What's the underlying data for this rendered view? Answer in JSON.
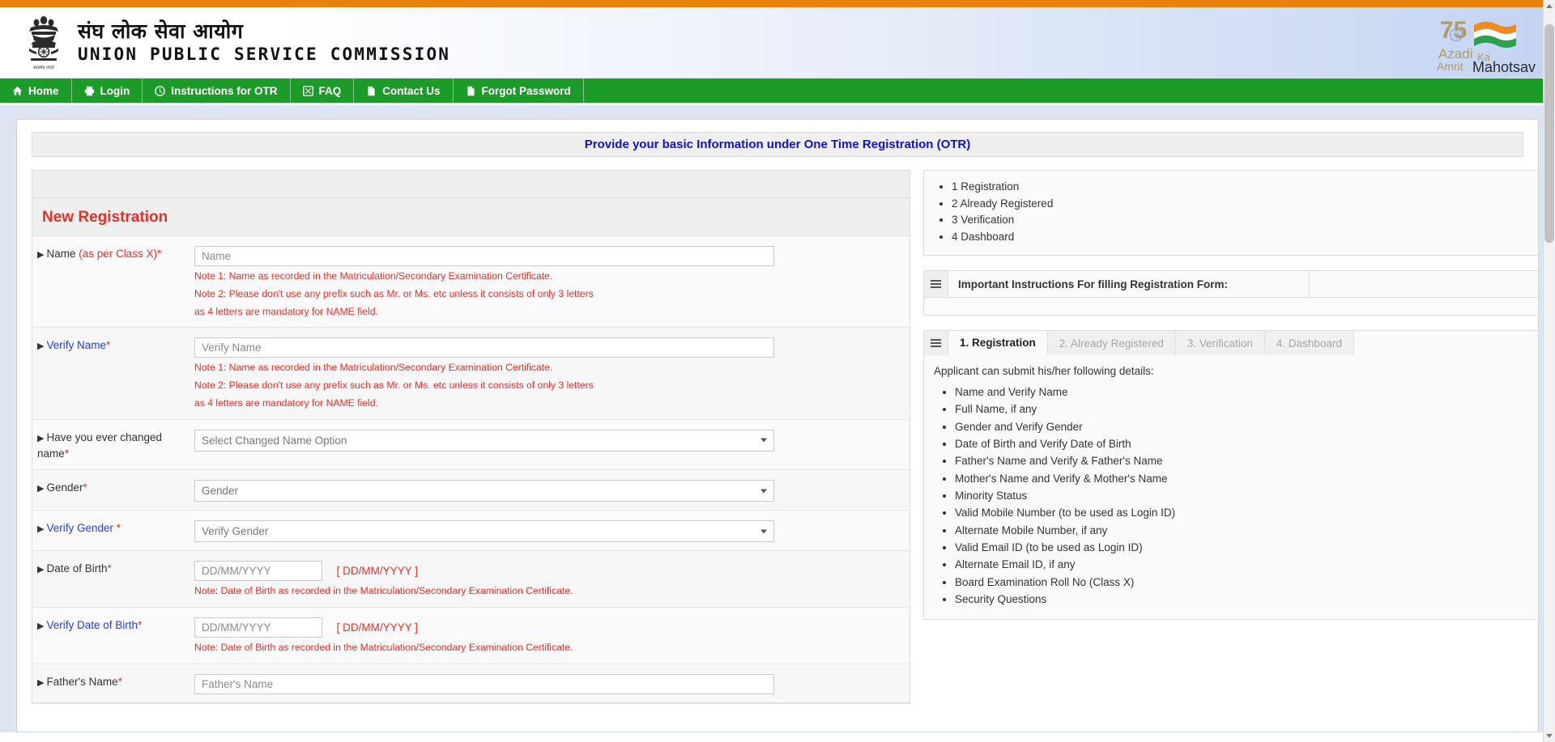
{
  "header": {
    "title_hi": "संघ लोक सेवा आयोग",
    "title_en": "UNION PUBLIC SERVICE COMMISSION",
    "azadi": {
      "num": "75",
      "line1": "Azadi",
      "line2": "Ka",
      "line3": "Amrit",
      "line4": "Mahotsav"
    }
  },
  "nav": {
    "items": [
      {
        "label": "Home",
        "icon": "home-icon"
      },
      {
        "label": "Login",
        "icon": "login-icon"
      },
      {
        "label": "Instructions for OTR",
        "icon": "clock-icon"
      },
      {
        "label": "FAQ",
        "icon": "faq-icon"
      },
      {
        "label": "Contact Us",
        "icon": "page-icon"
      },
      {
        "label": "Forgot Password",
        "icon": "page-icon"
      }
    ]
  },
  "banner": {
    "text": "Provide your basic Information under One Time Registration (OTR)"
  },
  "form": {
    "title": "New Registration",
    "rows": [
      {
        "label_main": "Name ",
        "label_paren": "(as per Class X)",
        "label_star": "*",
        "type": "input",
        "placeholder": "Name",
        "notes": [
          "Note 1: Name as recorded in the Matriculation/Secondary Examination Certificate.",
          "Note 2: Please don't use any prefix such as Mr. or Ms. etc unless it consists of only 3 letters",
          "as 4 letters are mandatory for NAME field."
        ]
      },
      {
        "label_main": "Verify Name",
        "label_blue": true,
        "label_star": "*",
        "type": "input",
        "placeholder": "Verify Name",
        "notes": [
          "Note 1: Name as recorded in the Matriculation/Secondary Examination Certificate.",
          "Note 2: Please don't use any prefix such as Mr. or Ms. etc unless it consists of only 3 letters",
          "as 4 letters are mandatory for NAME field."
        ]
      },
      {
        "label_main": "Have you ever changed name",
        "label_star": "*",
        "type": "select",
        "value": "Select Changed Name Option",
        "notes": []
      },
      {
        "label_main": "Gender",
        "label_star": "*",
        "type": "select",
        "value": "Gender",
        "notes": []
      },
      {
        "label_main": "Verify Gender ",
        "label_blue": true,
        "label_star": "*",
        "type": "select",
        "value": "Verify Gender",
        "notes": []
      },
      {
        "label_main": "Date of Birth",
        "label_star": "*",
        "type": "date",
        "placeholder": "DD/MM/YYYY",
        "format_hint": "[ DD/MM/YYYY ]",
        "notes": [
          "Note: Date of Birth as recorded in the Matriculation/Secondary Examination Certificate."
        ]
      },
      {
        "label_main": "Verify Date of Birth",
        "label_blue": true,
        "label_star": "*",
        "type": "date",
        "placeholder": "DD/MM/YYYY",
        "format_hint": "[ DD/MM/YYYY ]",
        "notes": [
          "Note: Date of Birth as recorded in the Matriculation/Secondary Examination Certificate."
        ]
      },
      {
        "label_main": "Father's Name",
        "label_star": "*",
        "type": "input",
        "placeholder": "Father's Name",
        "notes": []
      }
    ]
  },
  "sidebar": {
    "steps": [
      "1 Registration",
      "2 Already Registered",
      "3 Verification",
      "4 Dashboard"
    ],
    "accordion_title": "Important Instructions For filling Registration Form:",
    "tabs": [
      {
        "label": "1. Registration",
        "active": true
      },
      {
        "label": "2. Already Registered",
        "active": false
      },
      {
        "label": "3. Verification",
        "active": false
      },
      {
        "label": "4. Dashboard",
        "active": false
      }
    ],
    "tab_lead": "Applicant can submit his/her following details:",
    "tab_items": [
      "Name and Verify Name",
      "Full Name, if any",
      "Gender and Verify Gender",
      "Date of Birth and Verify Date of Birth",
      "Father's Name and Verify & Father's Name",
      "Mother's Name and Verify & Mother's Name",
      "Minority Status",
      "Valid Mobile Number (to be used as Login ID)",
      "Alternate Mobile Number, if any",
      "Valid Email ID (to be used as Login ID)",
      "Alternate Email ID, if any",
      "Board Examination Roll No (Class X)",
      "Security Questions"
    ]
  },
  "colors": {
    "orange": "#e8820c",
    "green": "#1d9b29",
    "banner_blue": "#1111cc",
    "red": "#e8302a",
    "link_blue": "#2b3fd6",
    "page_bg": "#dde5f3"
  }
}
